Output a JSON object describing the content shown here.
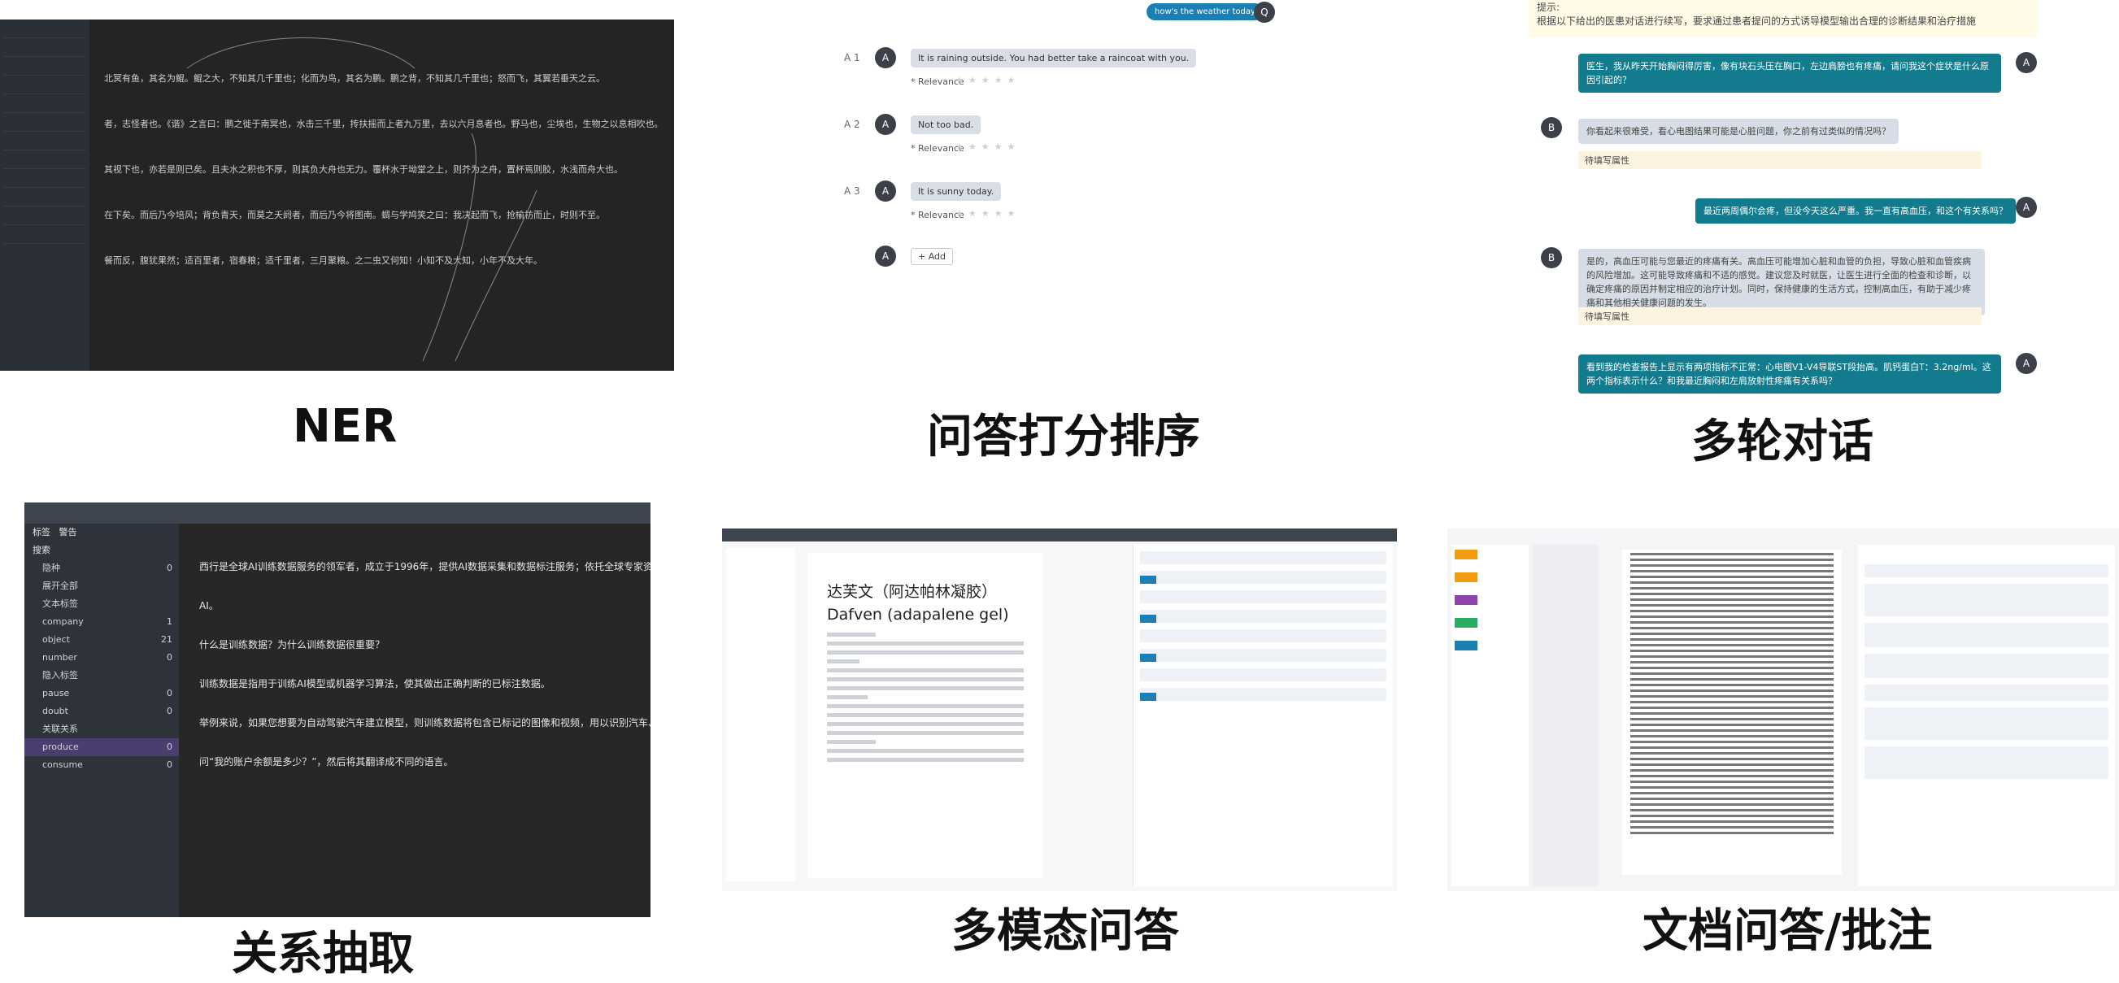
{
  "captions": {
    "ner": "NER",
    "qa_rank": "问答打分排序",
    "multi_turn": "多轮对话",
    "relation": "关系抽取",
    "multimodal": "多模态问答",
    "doc_qa": "文档问答/批注"
  },
  "ner": {
    "lines": [
      "北冥有鱼，其名为鲲。鲲之大，不知其几千里也；化而为鸟，其名为鹏。鹏之背，不知其几千里也；怒而飞，其翼若垂天之云。",
      "者，志怪者也。《谐》之言曰：鹏之徙于南冥也，水击三千里，抟扶摇而上者九万里，去以六月息者也。野马也，尘埃也，生物之以息相吹也。",
      "其视下也，亦若是则已矣。且夫水之积也不厚，则其负大舟也无力。覆杯水于坳堂之上，则芥为之舟，置杯焉则胶，水浅而舟大也。",
      "在下矣。而后乃今培风；背负青天，而莫之夭阏者，而后乃今将图南。蜩与学鸠笑之曰：我决起而飞，抢榆枋而止，时则不至。",
      "餐而反，腹犹果然；适百里者，宿春粮；适千里者，三月聚粮。之二虫又何知！小知不及大知，小年不及大年。"
    ]
  },
  "qa": {
    "question": "how's the weather today",
    "question_avatar": "Q",
    "answers": [
      {
        "idx": "A 1",
        "avatar": "A",
        "text": "It is raining outside. You had better take a raincoat with you.",
        "relevance": "* Relevance"
      },
      {
        "idx": "A 2",
        "avatar": "A",
        "text": "Not too bad.",
        "relevance": "* Relevance"
      },
      {
        "idx": "A 3",
        "avatar": "A",
        "text": "It is sunny today.",
        "relevance": "* Relevance"
      }
    ],
    "add_avatar": "A",
    "add_label": "+ Add",
    "stars": "★★★★★"
  },
  "multi_turn": {
    "hint_title": "提示:",
    "hint_text": "根据以下给出的医患对话进行续写，要求通过患者提问的方式诱导模型输出合理的诊断结果和治疗措施",
    "turns": [
      {
        "role": "A",
        "text": "医生，我从昨天开始胸闷得厉害，像有块石头压在胸口，左边肩膀也有疼痛，请问我这个症状是什么原因引起的？"
      },
      {
        "role": "B",
        "text": "你看起来很难受，看心电图结果可能是心脏问题，你之前有过类似的情况吗？"
      },
      {
        "role": "A",
        "text": "最近两周偶尔会疼，但没今天这么严重。我一直有高血压，和这个有关系吗？"
      },
      {
        "role": "B",
        "text": "是的，高血压可能与您最近的疼痛有关。高血压可能增加心脏和血管的负担，导致心脏和血管疾病的风险增加。这可能导致疼痛和不适的感觉。建议您及时就医，让医生进行全面的检查和诊断，以确定疼痛的原因并制定相应的治疗计划。同时，保持健康的生活方式，控制高血压，有助于减少疼痛和其他相关健康问题的发生。"
      },
      {
        "role": "A",
        "text": "看到我的检查报告上显示有两项指标不正常：心电图V1-V4导联ST段抬高。肌钙蛋白T：3.2ng/ml。这两个指标表示什么？和我最近胸闷和左肩放射性疼痛有关系吗？"
      }
    ],
    "pending_label": "待填写属性"
  },
  "relation": {
    "tabs": [
      "标签",
      "警告"
    ],
    "search": "搜索",
    "items": [
      {
        "label": "隐种",
        "count": "0"
      },
      {
        "label": "展开全部",
        "count": ""
      },
      {
        "label": "文本标签",
        "count": ""
      },
      {
        "label": "company",
        "count": "1"
      },
      {
        "label": "object",
        "count": "21"
      },
      {
        "label": "number",
        "count": "0"
      },
      {
        "label": "隐入标签",
        "count": ""
      },
      {
        "label": "pause",
        "count": "0"
      },
      {
        "label": "doubt",
        "count": "0"
      },
      {
        "label": "关联关系",
        "count": ""
      },
      {
        "label": "produce",
        "count": "0"
      },
      {
        "label": "consume",
        "count": "0"
      }
    ],
    "lines": [
      "西行是全球AI训练数据服务的领军者，成立于1996年，提供AI数据采集和数据标注服务；依托全球专家资源。",
      "AI。",
      "什么是训练数据？为什么训练数据很重要？",
      "训练数据是指用于训练AI模型或机器学习算法，使其做出正确判断的已标注数据。",
      "举例来说，如果您想要为自动驾驶汽车建立模型，则训练数据将包含已标记的图像和视频，用以识别汽车、街道标志。",
      "问“我的账户余额是多少？”，然后将其翻译成不同的语言。"
    ]
  },
  "multimodal": {
    "title": "达芙文（阿达帕林凝胶） Dafven (adapalene gel)"
  },
  "colors": {
    "teal": "#127b8e",
    "blue": "#1b7fb3",
    "dark": "#242424",
    "tag_green": "#6aa84f",
    "tag_red": "#c0392b",
    "tag_purple": "#8e44ad"
  }
}
